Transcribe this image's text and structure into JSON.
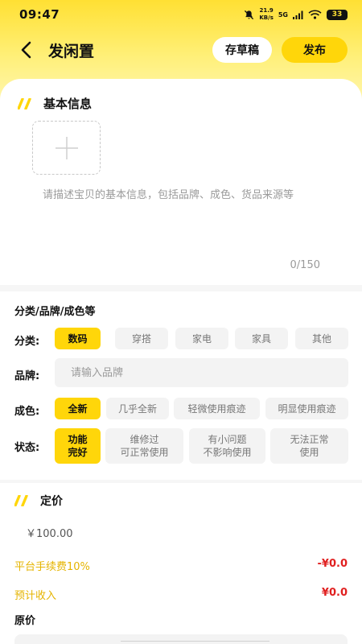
{
  "status_bar": {
    "time": "09:47",
    "speed_top": "21.9",
    "speed_bottom": "KB/s",
    "network": "5G",
    "battery": "33"
  },
  "header": {
    "title": "发闲置",
    "draft_label": "存草稿",
    "publish_label": "发布"
  },
  "basic_info": {
    "title": "基本信息",
    "description_placeholder": "请描述宝贝的基本信息，包括品牌、成色、货品来源等",
    "counter": "0/150"
  },
  "category_section": {
    "title": "分类/品牌/成色等",
    "category_label": "分类:",
    "categories": [
      "数码",
      "穿搭",
      "家电",
      "家具",
      "其他"
    ],
    "brand_label": "品牌:",
    "brand_placeholder": "请输入品牌",
    "condition_label": "成色:",
    "conditions": [
      "全新",
      "几乎全新",
      "轻微使用痕迹",
      "明显使用痕迹"
    ],
    "state_label": "状态:",
    "states": [
      {
        "line1": "功能",
        "line2": "完好"
      },
      {
        "line1": "维修过",
        "line2": "可正常使用"
      },
      {
        "line1": "有小问题",
        "line2": "不影响使用"
      },
      {
        "line1": "无法正常",
        "line2": "使用"
      }
    ]
  },
  "pricing": {
    "title": "定价",
    "price": "￥100.00",
    "fee_label": "平台手续费10%",
    "fee_value": "-¥0.0",
    "income_label": "预计收入",
    "income_value": "¥0.0",
    "original_price_label": "原价"
  },
  "colors": {
    "accent": "#ffd60a",
    "warning_text": "#e5b400",
    "price_red": "#e02020"
  }
}
